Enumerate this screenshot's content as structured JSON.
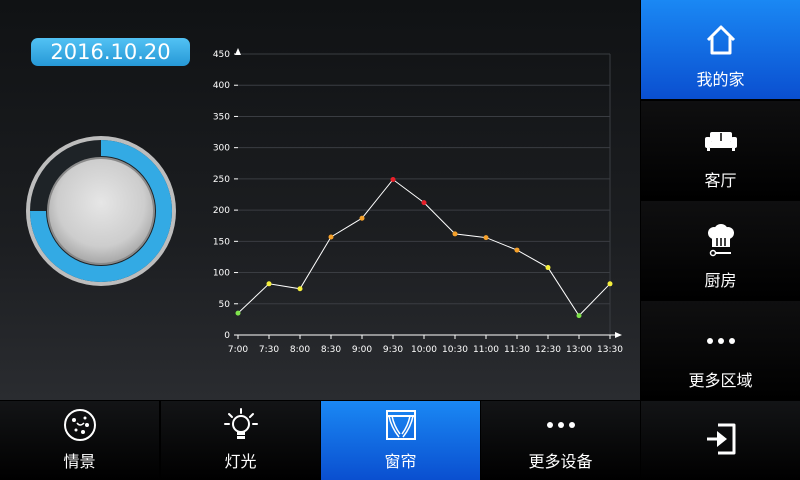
{
  "date": "2016.10.20",
  "gauge": {
    "fraction": 0.75,
    "ring_color": "#33aae4",
    "track_color": "#20262b"
  },
  "chart_data": {
    "type": "line",
    "x": [
      "7:00",
      "7:30",
      "8:00",
      "8:30",
      "9:00",
      "9:30",
      "10:00",
      "10:30",
      "11:00",
      "11:30",
      "12:30",
      "13:00",
      "13:30"
    ],
    "y_ticks": [
      0,
      50,
      100,
      150,
      200,
      250,
      300,
      350,
      400,
      450
    ],
    "points": [
      {
        "x": "7:00",
        "y": 35,
        "color": "#7fe34c"
      },
      {
        "x": "7:30",
        "y": 82,
        "color": "#f4ee3c"
      },
      {
        "x": "8:00",
        "y": 74,
        "color": "#f4ee3c"
      },
      {
        "x": "8:30",
        "y": 157,
        "color": "#f4a02a"
      },
      {
        "x": "9:00",
        "y": 187,
        "color": "#f4a02a"
      },
      {
        "x": "9:30",
        "y": 249,
        "color": "#e8202a"
      },
      {
        "x": "10:00",
        "y": 212,
        "color": "#e8202a"
      },
      {
        "x": "10:30",
        "y": 162,
        "color": "#f4a02a"
      },
      {
        "x": "11:00",
        "y": 156,
        "color": "#f4a02a"
      },
      {
        "x": "11:30",
        "y": 136,
        "color": "#f4a02a"
      },
      {
        "x": "12:30",
        "y": 108,
        "color": "#f4ee3c"
      },
      {
        "x": "13:00",
        "y": 31,
        "color": "#7fe34c"
      },
      {
        "x": "13:30",
        "y": 82,
        "color": "#f4ee3c"
      }
    ],
    "ylim": [
      0,
      450
    ],
    "grid": true,
    "line_color": "#ffffff",
    "axis_gradient": [
      "#7fe34c",
      "#f4ee3c",
      "#f4a02a",
      "#e8202a",
      "#f07080"
    ]
  },
  "side_menu": [
    {
      "label": "我的家",
      "icon": "home-icon",
      "active": true
    },
    {
      "label": "客厅",
      "icon": "sofa-icon",
      "active": false
    },
    {
      "label": "厨房",
      "icon": "chef-hat-icon",
      "active": false
    },
    {
      "label": "更多区域",
      "icon": "more-dots-icon",
      "active": false
    }
  ],
  "bottom_bar": [
    {
      "label": "情景",
      "icon": "scene-icon",
      "active": false
    },
    {
      "label": "灯光",
      "icon": "lightbulb-icon",
      "active": false
    },
    {
      "label": "窗帘",
      "icon": "curtain-icon",
      "active": true
    },
    {
      "label": "更多设备",
      "icon": "more-dots-icon",
      "active": false
    }
  ],
  "exit": {
    "icon": "exit-icon"
  },
  "colors": {
    "accent_blue": "#1a88f4",
    "date_badge": "#3aaee8"
  }
}
